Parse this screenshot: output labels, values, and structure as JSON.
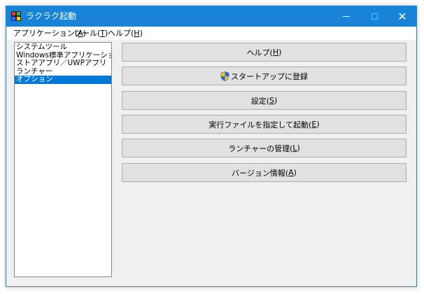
{
  "window": {
    "title": "ラクラク起動",
    "close_glyph": "✕"
  },
  "menu": {
    "items": [
      {
        "label": "アプリケーション(",
        "key": "A",
        "suffix": ")"
      },
      {
        "label": "ツール(",
        "key": "T",
        "suffix": ")"
      },
      {
        "label": "ヘルプ(",
        "key": "H",
        "suffix": ")"
      }
    ]
  },
  "list": {
    "items": [
      "システムツール",
      "Windows標準アプリケーション",
      "ストアアプリ／UWPアプリ",
      "ランチャー",
      "オプション"
    ],
    "selected_index": 4
  },
  "buttons": [
    {
      "label": "ヘルプ(",
      "key": "H",
      "suffix": ")"
    },
    {
      "label": "スタートアップに登録",
      "key": "",
      "suffix": "",
      "icon": "uac-shield-icon"
    },
    {
      "label": "設定(",
      "key": "S",
      "suffix": ")"
    },
    {
      "label": "実行ファイルを指定して起動(",
      "key": "E",
      "suffix": ")"
    },
    {
      "label": "ランチャーの管理(",
      "key": "L",
      "suffix": ")"
    },
    {
      "label": "バージョン情報(",
      "key": "A",
      "suffix": ")"
    }
  ],
  "colors": {
    "titlebar": "#1883d7",
    "selection": "#0078d7",
    "button_face": "#e1e1e1"
  }
}
